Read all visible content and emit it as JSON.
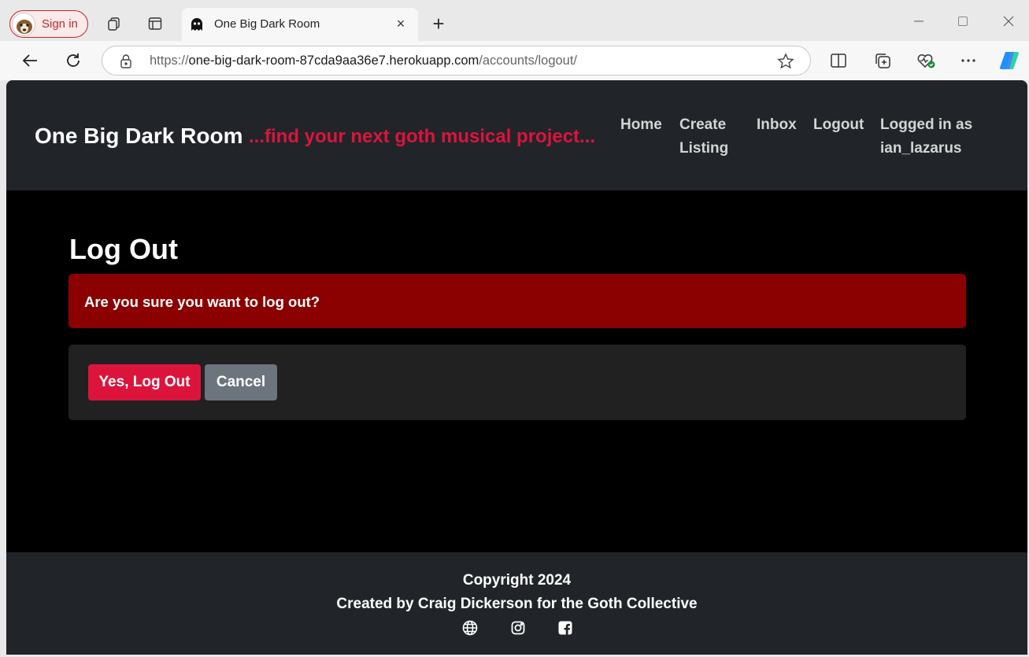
{
  "browser": {
    "signin_label": "Sign in",
    "tab_title": "One Big Dark Room",
    "tab_close": "×",
    "new_tab": "+",
    "url_scheme": "https://",
    "url_host": "one-big-dark-room-87cda9aa36e7.herokuapp.com",
    "url_path": "/accounts/logout/"
  },
  "site": {
    "brand": "One Big Dark Room",
    "tagline": "...find your next goth musical project...",
    "nav": {
      "home": "Home",
      "create_listing_line1": "Create",
      "create_listing_line2": "Listing",
      "inbox": "Inbox",
      "logout": "Logout",
      "logged_in_line1": "Logged in as",
      "logged_in_line2": "ian_lazarus"
    }
  },
  "main": {
    "title": "Log Out",
    "alert": "Are you sure you want to log out?",
    "confirm_button": "Yes, Log Out",
    "cancel_button": "Cancel"
  },
  "footer": {
    "copyright": "Copyright 2024",
    "credit": "Created by Craig Dickerson for the Goth Collective",
    "icons": [
      "globe-icon",
      "instagram-icon",
      "facebook-icon"
    ]
  },
  "colors": {
    "accent": "#dc143c",
    "alert_bg": "#8b0000",
    "nav_bg": "#212529",
    "cancel_bg": "#6c757d"
  }
}
